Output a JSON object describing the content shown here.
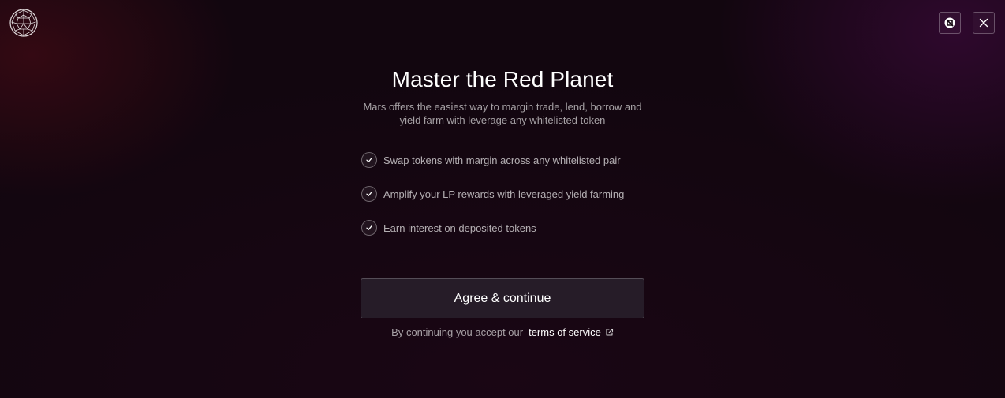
{
  "header": {
    "logo_icon": "mars-globe-logo-icon",
    "wallet_button_icon": "wallet-connect-icon",
    "close_button_icon": "close-icon"
  },
  "main": {
    "title": "Master the Red Planet",
    "subtitle": "Mars offers the easiest way to margin trade, lend, borrow and yield farm with leverage any whitelisted token",
    "features": [
      {
        "label": "Swap tokens with margin across any whitelisted pair",
        "icon": "checkmark-icon"
      },
      {
        "label": "Amplify your LP rewards with leveraged yield farming",
        "icon": "checkmark-icon"
      },
      {
        "label": "Earn interest on deposited tokens",
        "icon": "checkmark-icon"
      }
    ],
    "agree_button_label": "Agree & continue",
    "terms_prefix": "By continuing you accept our",
    "terms_link_label": "terms of service",
    "terms_link_icon": "external-link-icon"
  },
  "colors": {
    "background": "#12060f",
    "button_bg": "#261c28",
    "text_primary": "#ffffff"
  }
}
